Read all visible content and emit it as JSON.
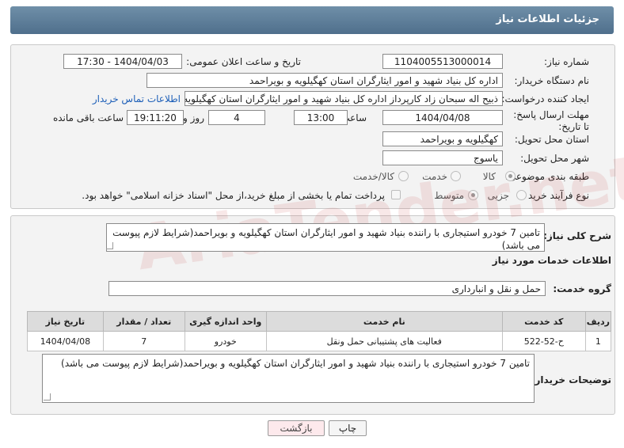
{
  "title": "جزئیات اطلاعات نیاز",
  "fields": {
    "need_number_label": "شماره نیاز:",
    "need_number": "1104005513000014",
    "announce_label": "تاریخ و ساعت اعلان عمومی:",
    "announce_value": "1404/04/03 - 17:30",
    "buyer_label": "نام دستگاه خریدار:",
    "buyer_value": "اداره کل بنیاد شهید و امور ایثارگران استان کهگیلویه و بویراحمد",
    "creator_label": "ایجاد کننده درخواست:",
    "creator_value": "ذبیح اله سبحان زاد کارپرداز اداره کل بنیاد شهید و امور ایثارگران استان کهگیلویه",
    "contact_link": "اطلاعات تماس خریدار",
    "deadline_label": "مهلت ارسال پاسخ: تا تاریخ:",
    "deadline_date": "1404/04/08",
    "time_label": "ساعت",
    "deadline_time": "13:00",
    "days_value": "4",
    "days_label": "روز و",
    "remaining_time": "19:11:20",
    "remaining_label": "ساعت باقی مانده",
    "province_label": "استان محل تحویل:",
    "province_value": "کهگیلویه و بویراحمد",
    "city_label": "شهر محل تحویل:",
    "city_value": "یاسوج",
    "category_label": "طبقه بندی موضوعی:",
    "category_options": [
      "کالا",
      "خدمت",
      "کالا/خدمت"
    ],
    "process_label": "نوع فرآیند خرید :",
    "process_options": [
      "جزیی",
      "متوسط"
    ],
    "payment_note": "پرداخت تمام یا بخشی از مبلغ خرید،از محل \"اسناد خزانه اسلامی\" خواهد بود."
  },
  "summary": {
    "label": "شرح کلی نیاز:",
    "text": "تامین 7 خودرو استیجاری با راننده بنیاد شهید و امور ایثارگران استان کهگیلویه و بویراحمد(شرایط لازم پیوست می باشد)"
  },
  "services": {
    "section_title": "اطلاعات خدمات مورد نیاز",
    "group_label": "گروه خدمت:",
    "group_value": "حمل و نقل و انبارداری",
    "columns": [
      "ردیف",
      "کد خدمت",
      "نام خدمت",
      "واحد اندازه گیری",
      "تعداد / مقدار",
      "تاریخ نیاز"
    ],
    "rows": [
      [
        "1",
        "ح-52-522",
        "فعالیت های پشتیبانی حمل ونقل",
        "خودرو",
        "7",
        "1404/04/08"
      ]
    ]
  },
  "buyer_notes": {
    "label": "توضیحات خریدار:",
    "text": "تامین 7 خودرو استیجاری با راننده بنیاد شهید و امور ایثارگران استان کهگیلویه و بویراحمد(شرایط لازم پیوست می باشد)"
  },
  "buttons": {
    "print": "چاپ",
    "back": "بازگشت"
  },
  "colors": {
    "header": "#5a7a96",
    "link": "#1d5fb8",
    "back_button": "#fde9ec",
    "print_button": "#f5f5f5"
  }
}
